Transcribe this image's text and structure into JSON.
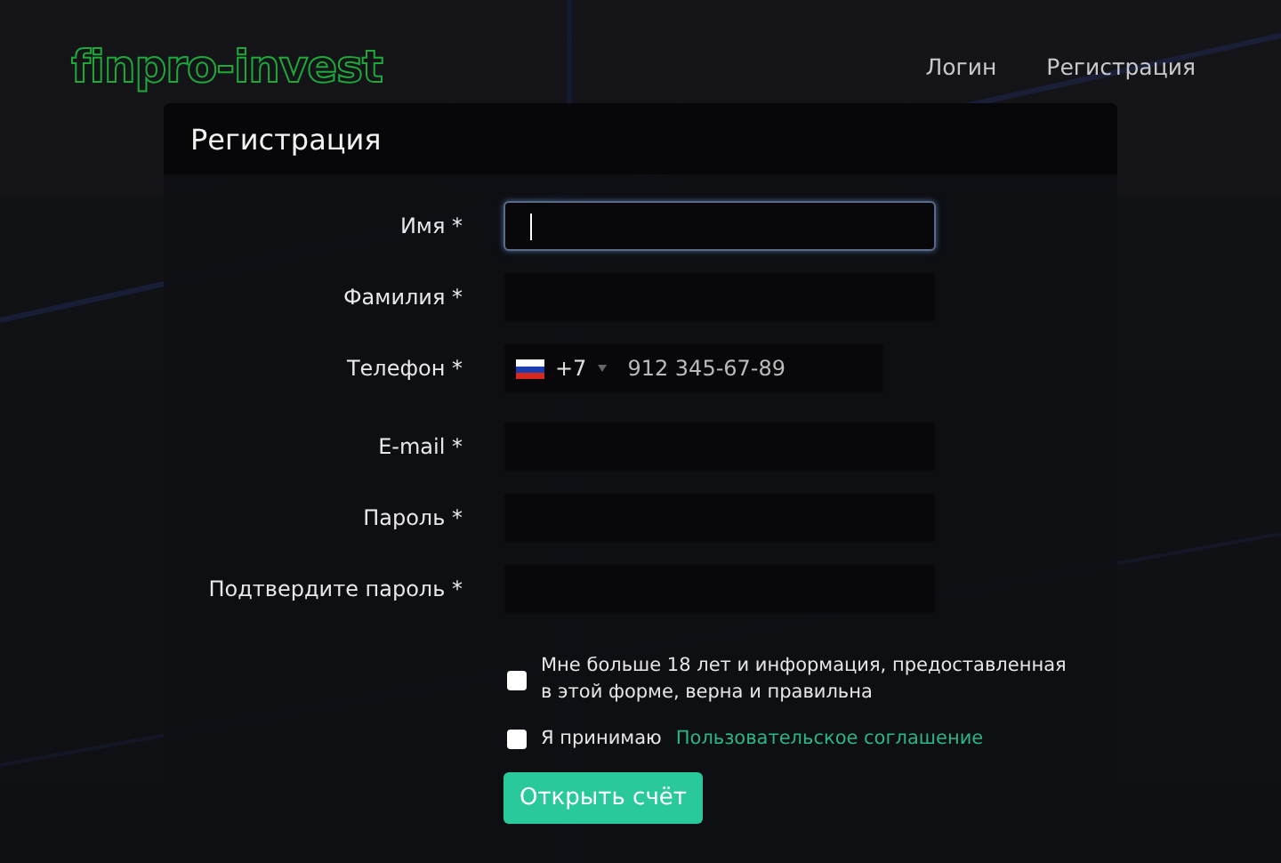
{
  "header": {
    "logo": "finpro-invest",
    "nav": [
      {
        "label": "Логин",
        "selected": false
      },
      {
        "label": "Регистрация",
        "selected": false
      }
    ]
  },
  "form": {
    "title": "Регистрация",
    "fields": [
      {
        "kind": "text",
        "label": "Имя *",
        "focused": true
      },
      {
        "kind": "text",
        "label": "Фамилия *",
        "focused": false
      },
      {
        "kind": "phone",
        "label": "Телефон *",
        "focused": false,
        "code": "+7",
        "placeholder": "912 345-67-89"
      },
      {
        "kind": "text",
        "label": "E-mail *",
        "focused": false
      },
      {
        "kind": "text",
        "label": "Пароль *",
        "focused": false
      },
      {
        "kind": "text",
        "label": "Подтвердите пароль *",
        "focused": false
      }
    ],
    "agreements": [
      {
        "text": "Мне больше 18 лет и информация, предоставленная в этой форме, верна и правильна",
        "checked": false
      },
      {
        "text": "Я принимаю",
        "link": "Пользовательское соглашение",
        "checked": false
      }
    ],
    "submit": "Открыть счёт"
  }
}
